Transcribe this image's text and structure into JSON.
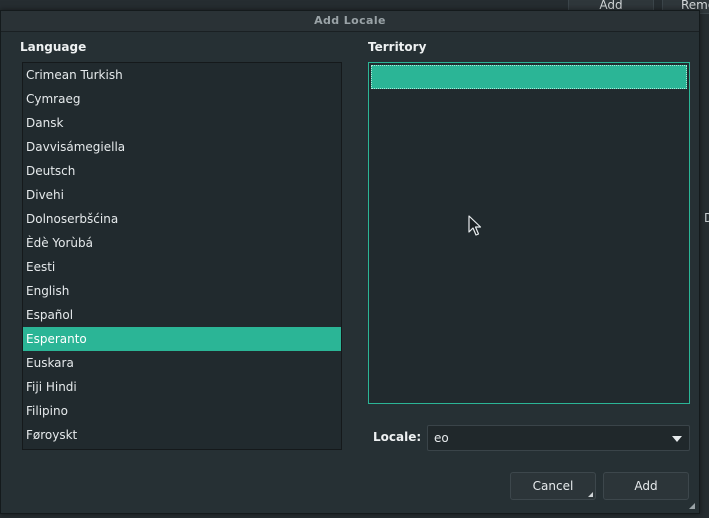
{
  "background": {
    "add_label": "Add",
    "remove_label": "Remo",
    "side_text": "D"
  },
  "dialog": {
    "title": "Add Locale",
    "language_label": "Language",
    "territory_label": "Territory",
    "languages": [
      "Crimean Turkish",
      "Cymraeg",
      "Dansk",
      "Davvisámegiella",
      "Deutsch",
      "Divehi",
      "Dolnoserbšćina",
      "Èdè Yorùbá",
      "Eesti",
      "English",
      "Español",
      "Esperanto",
      "Euskara",
      "Fiji Hindi",
      "Filipino",
      "Føroyskt"
    ],
    "selected_language": "Esperanto",
    "territories": [
      ""
    ],
    "locale_label": "Locale:",
    "locale_value": "eo",
    "cancel_label": "Cancel",
    "add_label": "Add"
  },
  "colors": {
    "accent": "#2bb596",
    "dialog_bg": "#263034",
    "list_bg": "#212a2e"
  }
}
